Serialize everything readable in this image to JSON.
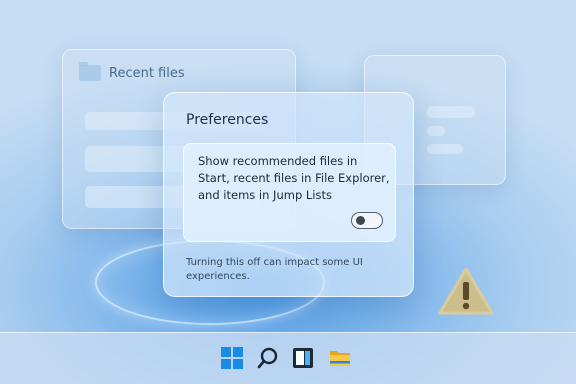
{
  "background_window": {
    "title": "Recent files",
    "icon": "folder-icon"
  },
  "dialog": {
    "title": "Preferences",
    "option_text": "Show recommended files in Start, recent files in File Explorer, and items in Jump Lists",
    "toggle_state": "off",
    "footnote": "Turning this off can impact some UI experiences."
  },
  "warning_icon": "warning-triangle-icon",
  "taskbar": {
    "icons": [
      "start-icon",
      "search-icon",
      "widgets-icon",
      "file-explorer-icon"
    ]
  },
  "colors": {
    "accent": "#0078d4",
    "warning": "#c2b079"
  }
}
